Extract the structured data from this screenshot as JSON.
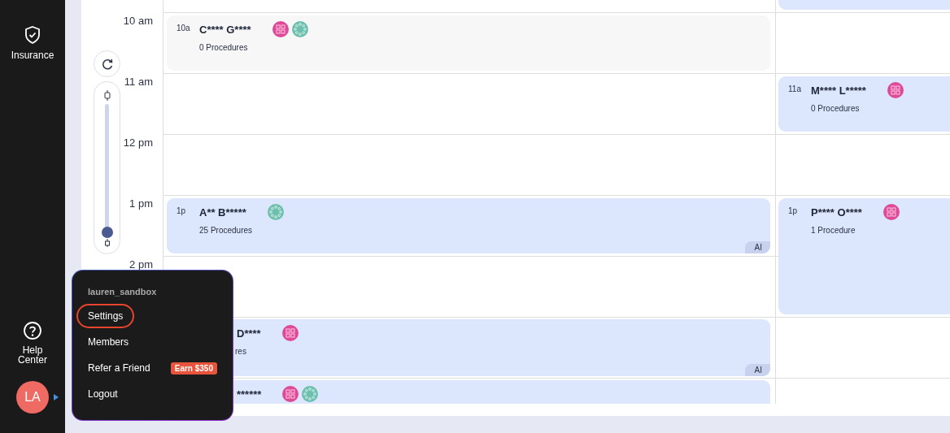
{
  "sidebar": {
    "items": [
      {
        "kind": "insurance",
        "label": "Insurance"
      },
      {
        "kind": "help",
        "label": "Help Center"
      }
    ],
    "avatar": {
      "initials": "LA"
    }
  },
  "calendar": {
    "times": [
      "10 am",
      "11 am",
      "12 pm",
      "1 pm",
      "2 pm"
    ],
    "zoom_slider": {
      "level": 0
    },
    "events": [
      {
        "kind": "continued",
        "color": "#dce6fd"
      },
      {
        "kind": "full",
        "time": "10a",
        "name": "C**** G****",
        "detail": "0 Procedures",
        "icons": [
          {
            "kind": "grid"
          },
          {
            "kind": "dots"
          }
        ],
        "color": "#f7f7f8"
      },
      {
        "kind": "full",
        "time": "11a",
        "name": "M**** L*****",
        "detail": "0 Procedures",
        "icons": [
          {
            "kind": "grid"
          }
        ],
        "color": "#dce6fd"
      },
      {
        "kind": "full",
        "time": "1p",
        "name": "A** B*****",
        "detail": "25 Procedures",
        "icons": [
          {
            "kind": "dots"
          }
        ],
        "color": "#dce6fd",
        "badge": "AI"
      },
      {
        "kind": "full",
        "time": "1p",
        "name": "P**** O****",
        "detail": "1 Procedure",
        "icons": [
          {
            "kind": "grid"
          }
        ],
        "color": "#dce6fd"
      },
      {
        "kind": "partial",
        "name": "D****",
        "detail": "res",
        "icons": [
          {
            "kind": "grid"
          }
        ],
        "color": "#dce6fd",
        "badge": "AI"
      },
      {
        "kind": "partial",
        "name": "******",
        "icons": [
          {
            "kind": "grid"
          },
          {
            "kind": "dots"
          }
        ],
        "color": "#dce6fd"
      }
    ]
  },
  "user_menu": {
    "username": "lauren_sandbox",
    "items": [
      {
        "label": "Settings",
        "highlighted": true
      },
      {
        "label": "Members",
        "highlighted": false
      },
      {
        "label": "Refer a Friend",
        "highlighted": false,
        "badge": "Earn $350"
      },
      {
        "label": "Logout",
        "highlighted": false
      }
    ]
  }
}
